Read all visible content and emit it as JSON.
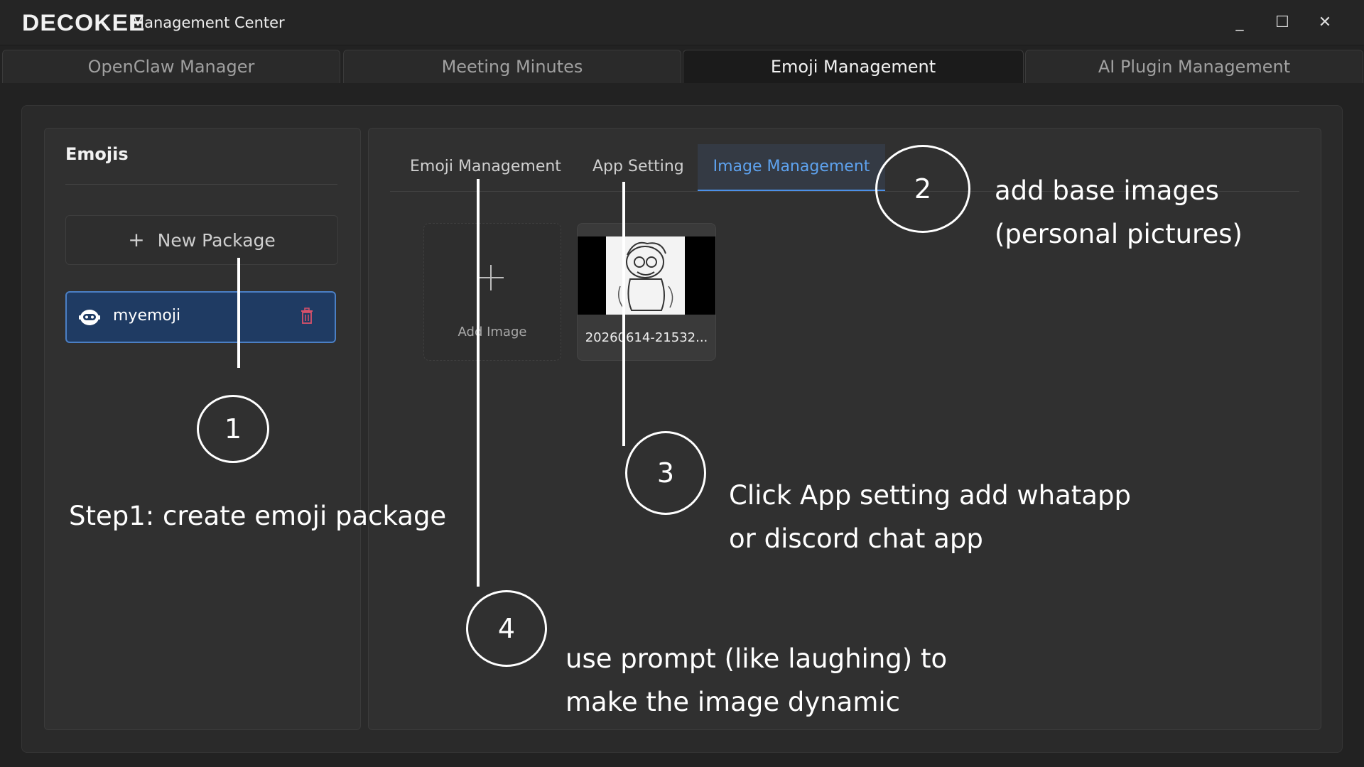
{
  "titlebar": {
    "logo": "DECOKEE",
    "title": "Management Center",
    "minimize": "_",
    "maximize": "☐",
    "close": "✕"
  },
  "top_tabs": [
    {
      "label": "OpenClaw Manager"
    },
    {
      "label": "Meeting Minutes"
    },
    {
      "label": "Emoji Management",
      "active": true
    },
    {
      "label": "AI Plugin Management"
    }
  ],
  "sidebar": {
    "title": "Emojis",
    "new_package_label": "New Package",
    "packages": [
      {
        "label": "myemoji",
        "icon": "robot-icon",
        "selected": true
      }
    ]
  },
  "main": {
    "sub_tabs": [
      {
        "label": "Emoji Management"
      },
      {
        "label": "App Setting"
      },
      {
        "label": "Image Management",
        "active": true
      }
    ],
    "add_image_label": "Add Image",
    "images": [
      {
        "file_name": "20260614-21532..."
      }
    ]
  },
  "annotations": {
    "step1": {
      "number": "1",
      "text": "Step1: create emoji package"
    },
    "step2": {
      "number": "2",
      "line1": "add base images",
      "line2": "(personal pictures)"
    },
    "step3": {
      "number": "3",
      "line1": "Click App setting add whatapp",
      "line2": "or discord chat app"
    },
    "step4": {
      "number": "4",
      "line1": "use prompt (like laughing) to",
      "line2": "make the image dynamic"
    }
  },
  "colors": {
    "accent": "#4c90e8",
    "selected_bg": "#1f3b63",
    "background": "#222222"
  }
}
